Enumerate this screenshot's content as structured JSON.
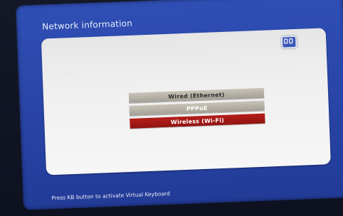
{
  "title": "Network information",
  "menu": {
    "items": [
      {
        "label": "Wired (Ethernet)"
      },
      {
        "label": "PPPoE"
      },
      {
        "label": "Wireless (Wi-Fi)"
      }
    ],
    "selected_index": 2
  },
  "hint": "Press KB button to activate Virtual Keyboard",
  "icons": {
    "virtual_keyboard": "virtual-keyboard-icon"
  },
  "colors": {
    "background_blue": "#2a46a9",
    "panel": "#f0f0f0",
    "menu_item": "#a49f95",
    "selected_item": "#b61e1a"
  }
}
